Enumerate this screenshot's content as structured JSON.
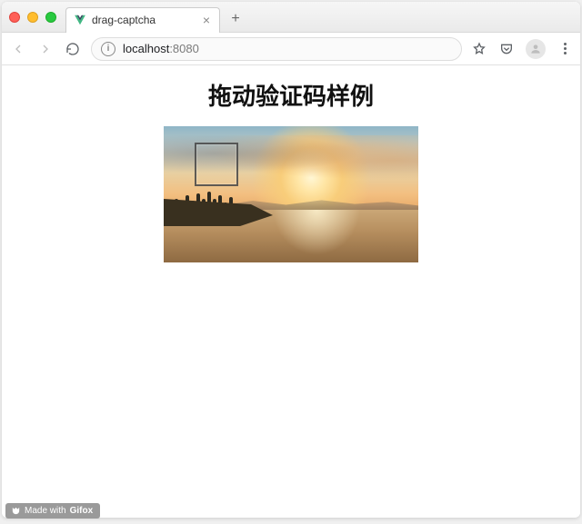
{
  "browser": {
    "tab_title": "drag-captcha",
    "url_host": "localhost",
    "url_port": ":8080"
  },
  "page": {
    "heading": "拖动验证码样例"
  },
  "badge": {
    "prefix": "Made with ",
    "brand": "Gifox"
  }
}
